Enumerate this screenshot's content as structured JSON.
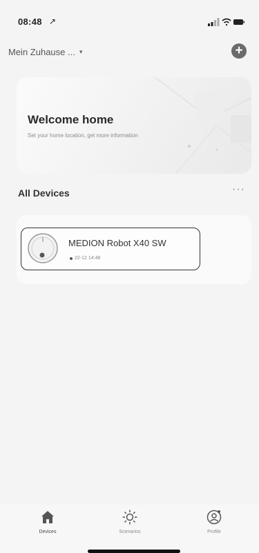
{
  "status_bar": {
    "time": "08:48",
    "location_glyph": "↗"
  },
  "header": {
    "home_name": "Mein Zuhause ...",
    "caret": "▾",
    "add_label": "+"
  },
  "welcome": {
    "title": "Welcome home",
    "subtitle": "Set your home location, get more information"
  },
  "devices_section": {
    "title": "All Devices",
    "more_label": "···"
  },
  "device": {
    "name": "MEDION Robot X40 SW",
    "status_text": "22-12 14:48"
  },
  "tabs": [
    {
      "label": "Devices",
      "icon": "home-icon",
      "active": true
    },
    {
      "label": "Scenarios",
      "icon": "sun-icon",
      "active": false
    },
    {
      "label": "Profile",
      "icon": "profile-icon",
      "active": false
    }
  ],
  "colors": {
    "background": "#f4f4f5",
    "card": "#fdfdfd",
    "accent": "#333333"
  }
}
